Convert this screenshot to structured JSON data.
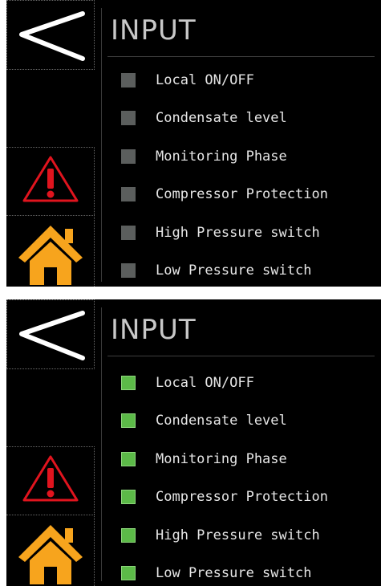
{
  "panels": [
    {
      "state": "inactive",
      "title": "INPUT",
      "inputs": [
        {
          "label": "Local ON/OFF",
          "active": false
        },
        {
          "label": "Condensate level",
          "active": false
        },
        {
          "label": "Monitoring Phase",
          "active": false
        },
        {
          "label": "Compressor Protection",
          "active": false
        },
        {
          "label": "High Pressure switch",
          "active": false
        },
        {
          "label": "Low Pressure switch",
          "active": false
        }
      ]
    },
    {
      "state": "active",
      "title": "INPUT",
      "inputs": [
        {
          "label": "Local ON/OFF",
          "active": true
        },
        {
          "label": "Condensate level",
          "active": true
        },
        {
          "label": "Monitoring Phase",
          "active": true
        },
        {
          "label": "Compressor Protection",
          "active": true
        },
        {
          "label": "High Pressure switch",
          "active": true
        },
        {
          "label": "Low Pressure switch",
          "active": true
        }
      ]
    }
  ],
  "icons": {
    "back": "back-arrow-icon",
    "alarm": "warning-triangle-icon",
    "home": "home-icon"
  },
  "colors": {
    "led_off": "#5b5e5d",
    "led_on": "#5cba48",
    "alarm_red": "#e0141e",
    "home_orange": "#f7a41d"
  }
}
